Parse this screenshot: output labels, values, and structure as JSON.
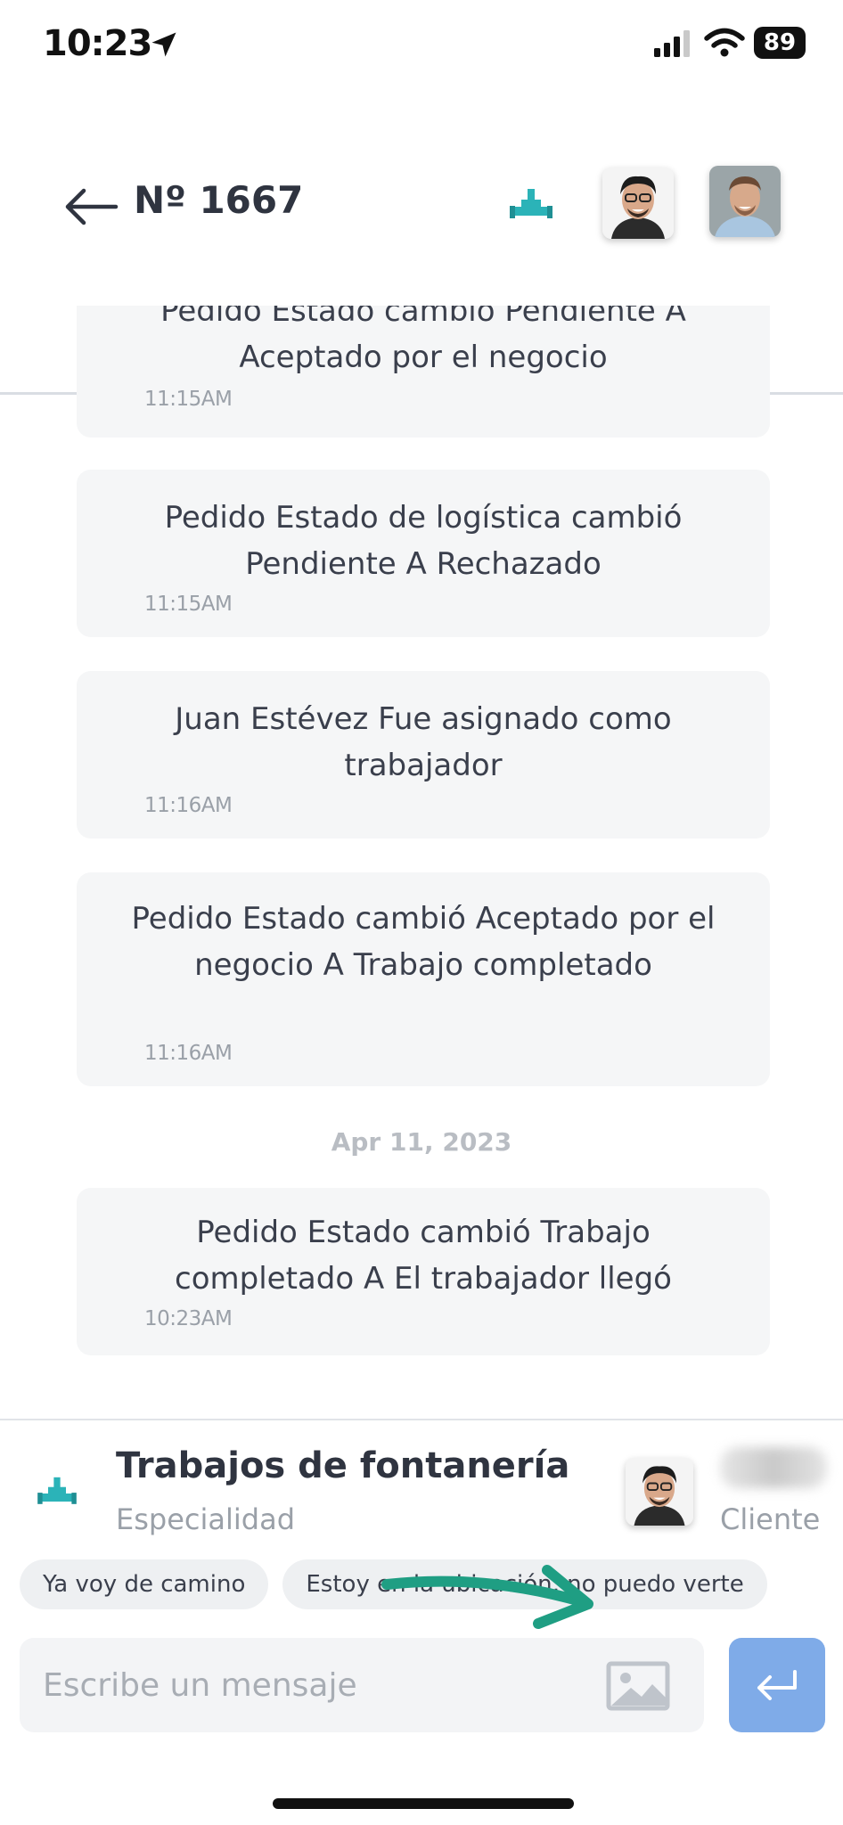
{
  "status_bar": {
    "time": "10:23",
    "battery": "89"
  },
  "header": {
    "title": "Nº 1667"
  },
  "messages": [
    {
      "text": "Pedido Estado cambio Pendiente A Aceptado por el negocio",
      "time": "11:15AM"
    },
    {
      "text": "Pedido Estado de logística cambió Pendiente A Rechazado",
      "time": "11:15AM"
    },
    {
      "text": "Juan Estévez  Fue asignado como trabajador",
      "time": "11:16AM"
    },
    {
      "text": "Pedido Estado cambió Aceptado por el negocio A Trabajo completado",
      "time": "11:16AM"
    },
    {
      "text": "Pedido Estado cambió Trabajo completado A El trabajador llegó",
      "time": "10:23AM"
    }
  ],
  "date_separator": "Apr 11, 2023",
  "specialty": {
    "name": "Trabajos de fontanería",
    "label": "Especialidad"
  },
  "client": {
    "label": "Cliente"
  },
  "quick_replies": [
    "Ya voy de camino",
    "Estoy en la ubicación, no puedo verte"
  ],
  "composer": {
    "placeholder": "Escribe un mensaje"
  },
  "colors": {
    "accent": "#2bb3b8",
    "send_button": "#7fabe8",
    "annotation": "#1f9e83"
  }
}
